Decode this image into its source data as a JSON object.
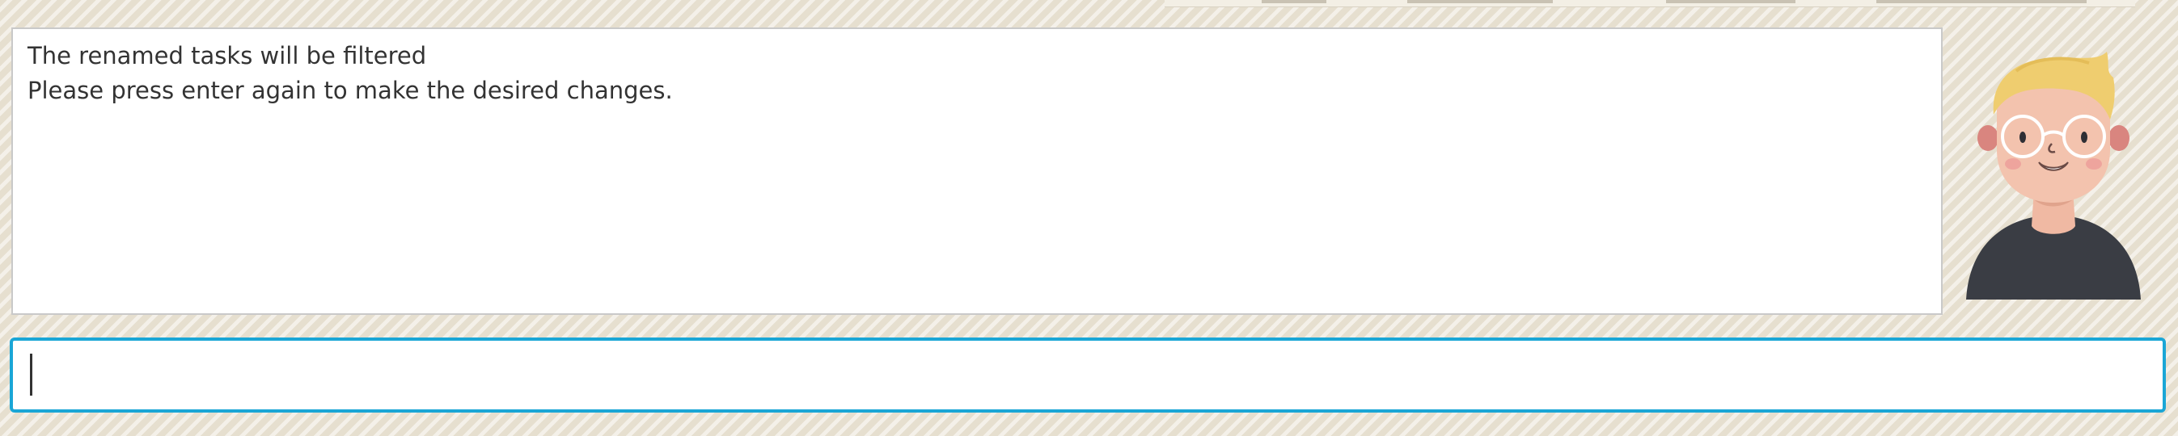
{
  "output": {
    "lines": [
      "The renamed tasks will be filtered",
      "Please press enter again to make the desired changes."
    ]
  },
  "command_input": {
    "value": "",
    "placeholder": ""
  },
  "icons": {
    "avatar": "user-avatar-icon"
  },
  "colors": {
    "background": "#e6dfcf",
    "input_border": "#1aa6d6",
    "text": "#333333"
  }
}
